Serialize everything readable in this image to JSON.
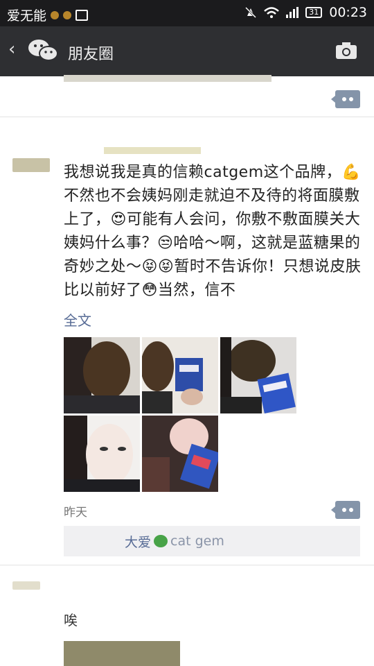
{
  "status_bar": {
    "carrier": "爱无能",
    "battery": "31",
    "time": "00:23"
  },
  "header": {
    "back_icon": "back-chevron",
    "title": "朋友圈",
    "camera_icon": "camera-icon"
  },
  "post": {
    "text": "我想说我是真的信赖catgem这个品牌，💪不然也不会姨妈刚走就迫不及待的将面膜敷上了，😍可能有人会问，你敷不敷面膜关大姨妈什么事？😒哈哈～啊，这就是蓝糖果的奇妙之处～😝😝暂时不告诉你！只想说皮肤比以前好了😳当然，信不",
    "full_text_link": "全文",
    "time": "昨天",
    "likes": {
      "text_before": "大爱",
      "text_after": "cat gem"
    },
    "photos": [
      {
        "desc": "face-mask-1"
      },
      {
        "desc": "face-mask-2"
      },
      {
        "desc": "face-mask-3"
      },
      {
        "desc": "selfie-4"
      },
      {
        "desc": "selfie-5"
      }
    ]
  },
  "next_post": {
    "partial_text": "唉"
  },
  "colors": {
    "status_bg": "#1b1b1d",
    "titlebar_bg": "#2e2f32",
    "link": "#576b95",
    "comment_button": "#8494a9"
  }
}
